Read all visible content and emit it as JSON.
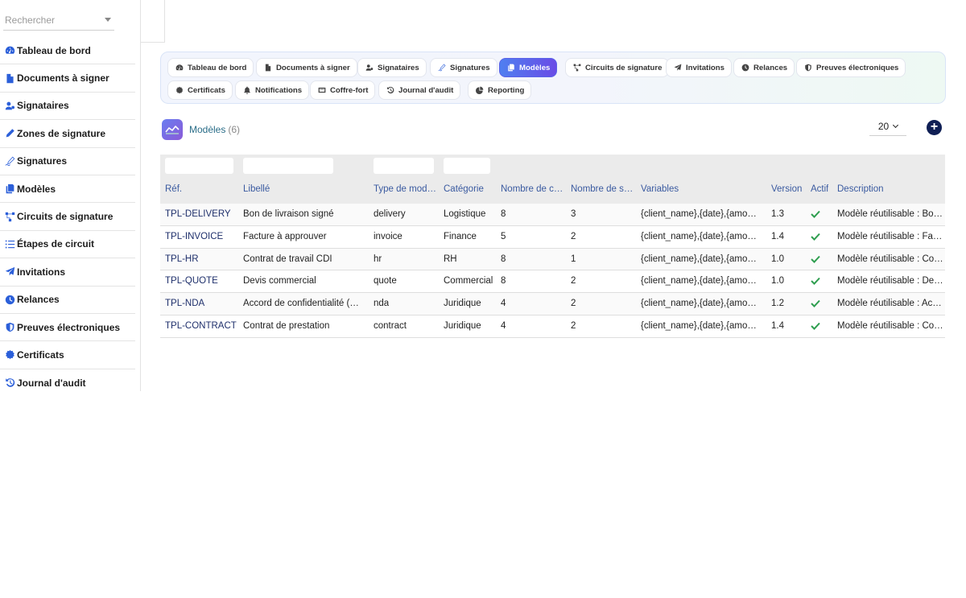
{
  "search": {
    "placeholder": "Rechercher"
  },
  "sidebar": {
    "items": [
      {
        "label": "Tableau de bord",
        "icon": "gauge-icon"
      },
      {
        "label": "Documents à signer",
        "icon": "file-icon"
      },
      {
        "label": "Signataires",
        "icon": "user-gear-icon"
      },
      {
        "label": "Zones de signature",
        "icon": "pen-icon"
      },
      {
        "label": "Signatures",
        "icon": "signature-icon"
      },
      {
        "label": "Modèles",
        "icon": "copy-icon"
      },
      {
        "label": "Circuits de signature",
        "icon": "diagram-icon"
      },
      {
        "label": "Étapes de circuit",
        "icon": "list-icon"
      },
      {
        "label": "Invitations",
        "icon": "paper-plane-icon"
      },
      {
        "label": "Relances",
        "icon": "clock-icon"
      },
      {
        "label": "Preuves électroniques",
        "icon": "shield-icon"
      },
      {
        "label": "Certificats",
        "icon": "badge-icon"
      },
      {
        "label": "Journal d'audit",
        "icon": "history-icon"
      }
    ]
  },
  "tabs": [
    {
      "label": "Tableau de bord",
      "icon": "gauge-icon"
    },
    {
      "label": "Documents à signer",
      "icon": "file-icon"
    },
    {
      "label": "Signataires",
      "icon": "user-gear-icon"
    },
    {
      "label": "Signatures",
      "icon": "signature-icon"
    },
    {
      "label": "Modèles",
      "icon": "copy-icon",
      "active": true
    },
    {
      "label": "Circuits de signature",
      "icon": "diagram-icon"
    },
    {
      "label": "Invitations",
      "icon": "paper-plane-icon"
    },
    {
      "label": "Relances",
      "icon": "clock-icon"
    },
    {
      "label": "Preuves électroniques",
      "icon": "shield-icon"
    },
    {
      "label": "Certificats",
      "icon": "badge-icon"
    },
    {
      "label": "Notifications",
      "icon": "bell-icon"
    },
    {
      "label": "Coffre-fort",
      "icon": "vault-icon"
    },
    {
      "label": "Journal d'audit",
      "icon": "history-icon"
    },
    {
      "label": "Reporting",
      "icon": "pie-icon"
    }
  ],
  "page": {
    "title": "Modèles",
    "count": "(6)",
    "page_size": "20"
  },
  "colors": {
    "accent": "#5a62e8",
    "link": "#1e2f6b",
    "check": "#2e9e4f",
    "sidebar_icon": "#2b5fd9",
    "add_button": "#0f1f55"
  },
  "table": {
    "columns": [
      "Réf.",
      "Libellé",
      "Type de modèle",
      "Catégorie",
      "Nombre de champs",
      "Nombre de signataires",
      "Variables",
      "Version",
      "Actif",
      "Description"
    ],
    "rows": [
      {
        "ref": "TPL-DELIVERY",
        "label": "Bon de livraison signé",
        "type": "delivery",
        "category": "Logistique",
        "fields": "8",
        "signers": "3",
        "variables": "{client_name},{date},{amount}",
        "version": "1.3",
        "active": true,
        "description": "Modèle réutilisable : Bon de livraison signé"
      },
      {
        "ref": "TPL-INVOICE",
        "label": "Facture à approuver",
        "type": "invoice",
        "category": "Finance",
        "fields": "5",
        "signers": "2",
        "variables": "{client_name},{date},{amount}",
        "version": "1.4",
        "active": true,
        "description": "Modèle réutilisable : Facture à approuver"
      },
      {
        "ref": "TPL-HR",
        "label": "Contrat de travail CDI",
        "type": "hr",
        "category": "RH",
        "fields": "8",
        "signers": "1",
        "variables": "{client_name},{date},{amount}",
        "version": "1.0",
        "active": true,
        "description": "Modèle réutilisable : Contrat de travail CDI"
      },
      {
        "ref": "TPL-QUOTE",
        "label": "Devis commercial",
        "type": "quote",
        "category": "Commercial",
        "fields": "8",
        "signers": "2",
        "variables": "{client_name},{date},{amount}",
        "version": "1.0",
        "active": true,
        "description": "Modèle réutilisable : Devis commercial"
      },
      {
        "ref": "TPL-NDA",
        "label": "Accord de confidentialité (NDA)",
        "type": "nda",
        "category": "Juridique",
        "fields": "4",
        "signers": "2",
        "variables": "{client_name},{date},{amount}",
        "version": "1.2",
        "active": true,
        "description": "Modèle réutilisable : Accord de confidentialité"
      },
      {
        "ref": "TPL-CONTRACT",
        "label": "Contrat de prestation",
        "type": "contract",
        "category": "Juridique",
        "fields": "4",
        "signers": "2",
        "variables": "{client_name},{date},{amount}",
        "version": "1.4",
        "active": true,
        "description": "Modèle réutilisable : Contrat de prestation"
      }
    ]
  }
}
